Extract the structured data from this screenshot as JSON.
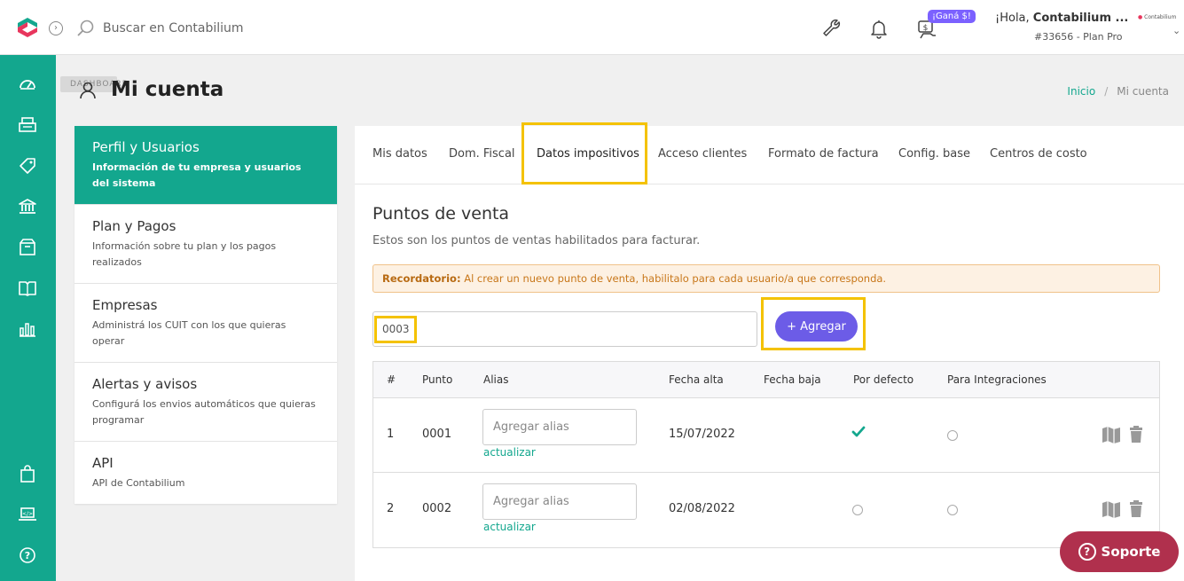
{
  "topbar": {
    "search_placeholder": "Buscar en Contabilium",
    "gana_badge": "¡Ganá $!",
    "greeting_prefix": "¡Hola, ",
    "greeting_name": "Contabilium ...",
    "plan_text": "#33656 - Plan Pro",
    "org_logo_text": "Contabilium"
  },
  "tooltip": "DASHBOARD",
  "page": {
    "title": "Mi cuenta",
    "breadcrumb": {
      "home": "Inicio",
      "separator": "/",
      "current": "Mi cuenta"
    }
  },
  "settings_menu": [
    {
      "title": "Perfil y Usuarios",
      "desc": "Información de tu empresa y usuarios del sistema"
    },
    {
      "title": "Plan y Pagos",
      "desc": "Información sobre tu plan y los pagos realizados"
    },
    {
      "title": "Empresas",
      "desc": "Administrá los CUIT con los que quieras operar"
    },
    {
      "title": "Alertas y avisos",
      "desc": "Configurá los envios automáticos que quieras programar"
    },
    {
      "title": "API",
      "desc": "API de Contabilium"
    }
  ],
  "tabs": [
    "Mis datos",
    "Dom. Fiscal",
    "Datos impositivos",
    "Acceso clientes",
    "Formato de factura",
    "Config. base",
    "Centros de costo"
  ],
  "active_tab": "Datos impositivos",
  "section": {
    "title": "Puntos de venta",
    "desc": "Estos son los puntos de ventas habilitados para facturar.",
    "alert_label": "Recordatorio:",
    "alert_text": " Al crear un nuevo punto de venta, habilitalo para cada usuario/a que corresponda.",
    "new_pv_value": "0003",
    "add_button": "+ Agregar"
  },
  "table": {
    "headers": [
      "#",
      "Punto",
      "Alias",
      "Fecha alta",
      "Fecha baja",
      "Por defecto",
      "Para Integraciones"
    ],
    "alias_placeholder": "Agregar alias",
    "update_label": "actualizar",
    "rows": [
      {
        "num": "1",
        "punto": "0001",
        "fecha_alta": "15/07/2022",
        "fecha_baja": "",
        "por_defecto": true,
        "integraciones": false
      },
      {
        "num": "2",
        "punto": "0002",
        "fecha_alta": "02/08/2022",
        "fecha_baja": "",
        "por_defecto": false,
        "integraciones": false
      }
    ]
  },
  "support_button": "Soporte",
  "colors": {
    "brand": "#13a78e",
    "accent": "#6c5ce7",
    "support": "#b0304d",
    "highlight": "#f4c200"
  }
}
